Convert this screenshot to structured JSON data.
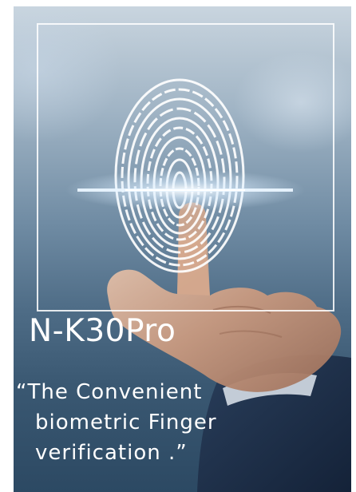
{
  "model_name": "N-K30Pro",
  "tagline": {
    "line1": "“The Convenient",
    "line2": "biometric Finger",
    "line3": "verification .”"
  },
  "colors": {
    "background": "#ffffff",
    "text": "#ffffff",
    "scan_line": "#cfe6ff",
    "frame": "#ffffff"
  }
}
